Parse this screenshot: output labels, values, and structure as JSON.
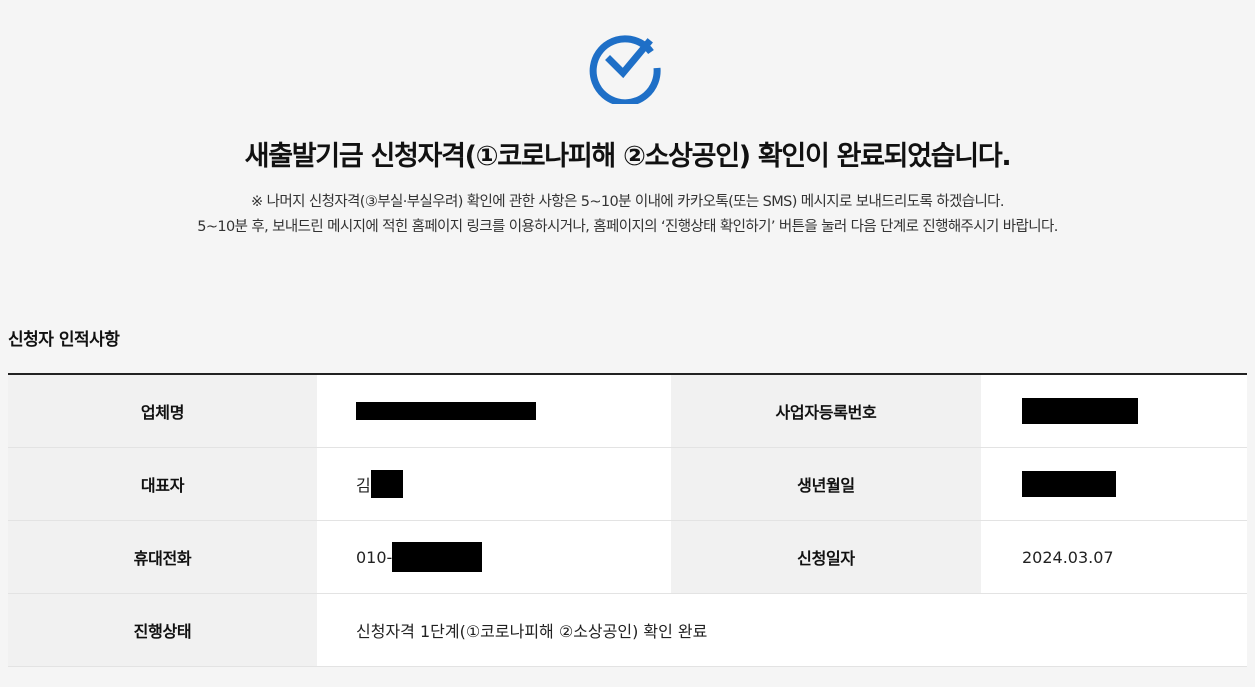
{
  "header": {
    "icon": "check-circle-icon",
    "accent_color": "#1e6fc7",
    "title": "새출발기금 신청자격(①코로나피해 ②소상공인) 확인이 완료되었습니다.",
    "notice_line1": "※ 나머지 신청자격(③부실·부실우려) 확인에 관한 사항은 5~10분 이내에 카카오톡(또는 SMS) 메시지로 보내드리도록 하겠습니다.",
    "notice_line2": "5~10분 후, 보내드린 메시지에 적힌 홈페이지 링크를 이용하시거나, 홈페이지의 ‘진행상태 확인하기’ 버튼을 눌러 다음 단계로 진행해주시기 바랍니다."
  },
  "section": {
    "title": "신청자 인적사항"
  },
  "applicant": {
    "company_label": "업체명",
    "company_value": "",
    "bizno_label": "사업자등록번호",
    "bizno_value": "",
    "rep_label": "대표자",
    "rep_value_prefix": "김",
    "birth_label": "생년월일",
    "birth_value": "",
    "phone_label": "휴대전화",
    "phone_value_prefix": "010-",
    "date_label": "신청일자",
    "date_value": "2024.03.07",
    "status_label": "진행상태",
    "status_value": "신청자격 1단계(①코로나피해 ②소상공인) 확인 완료"
  }
}
